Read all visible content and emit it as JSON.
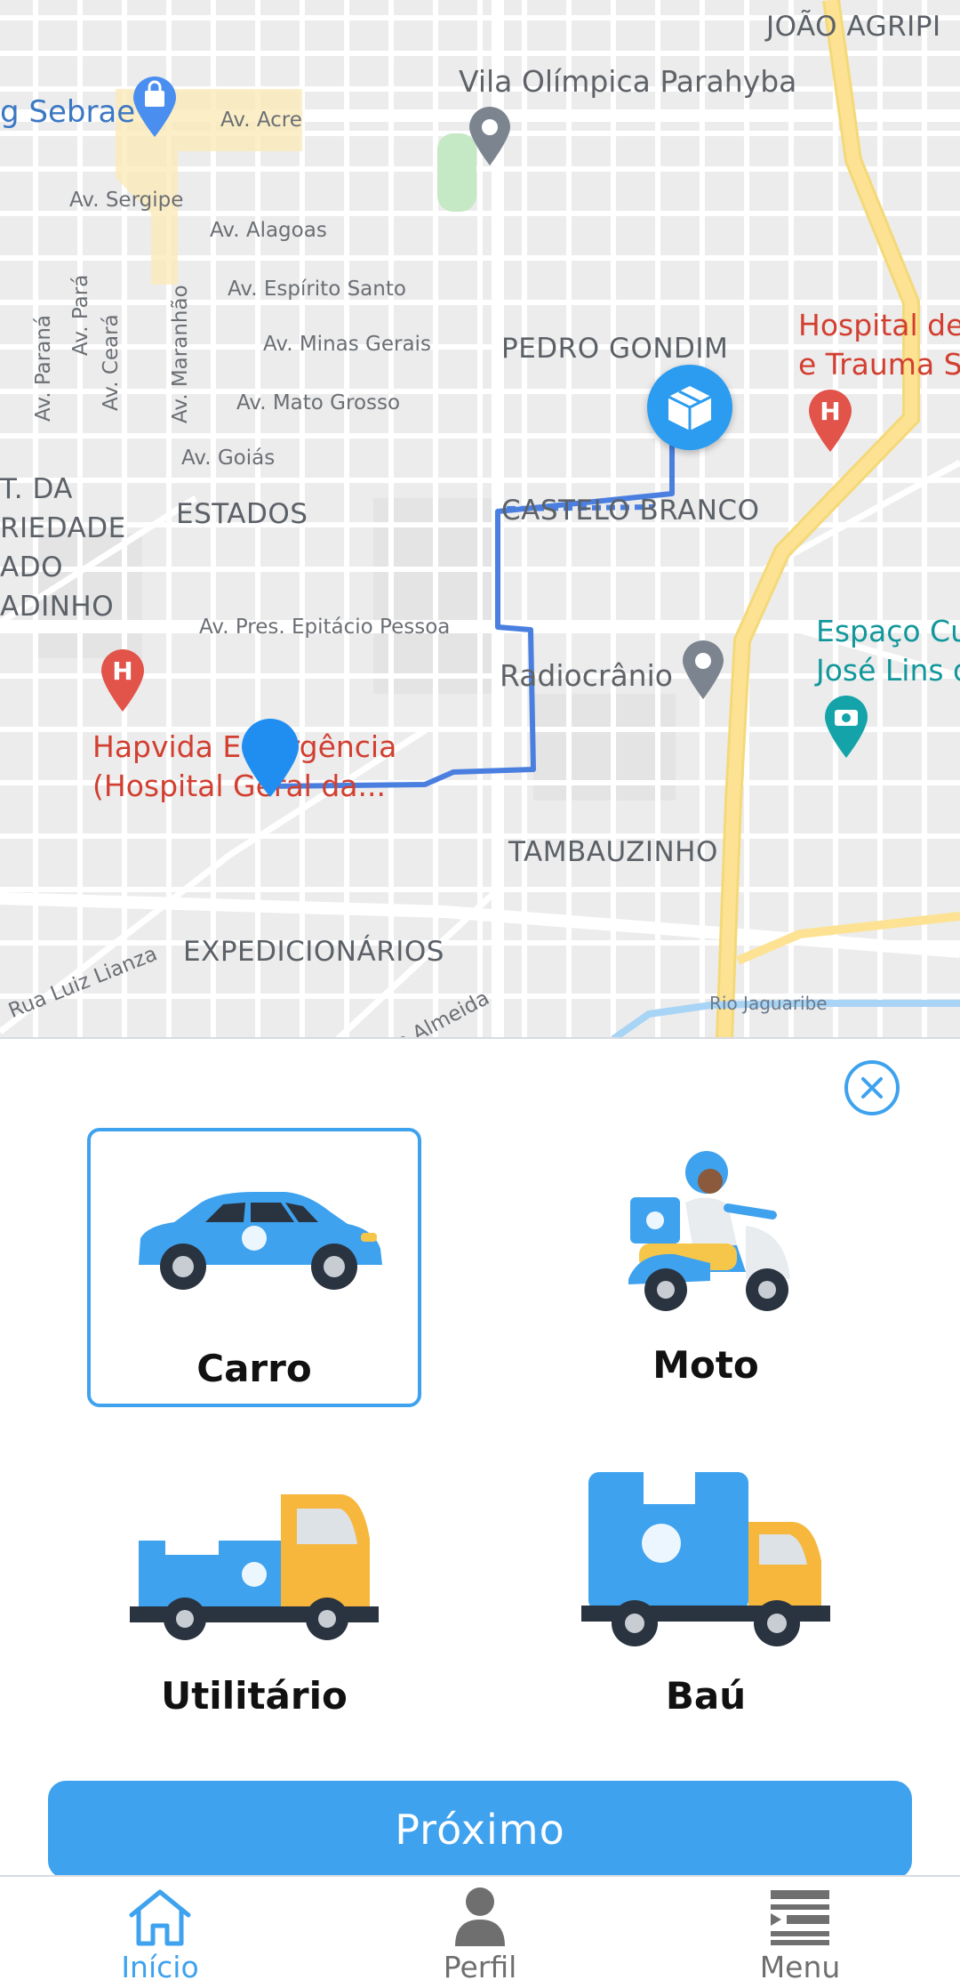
{
  "map": {
    "neighborhoods": {
      "joao_agripino": "JOÃO AGRIPI",
      "pedro_gondim": "PEDRO GONDIM",
      "castelo_branco": "CASTELO BRANCO",
      "estados": "ESTADOS",
      "tambauzinho": "TAMBAUZINHO",
      "expedicionarios": "EXPEDICIONÁRIOS",
      "partial_1": "T. DA",
      "partial_2": "RIEDADE",
      "partial_3": "ADO",
      "partial_4": "ADINHO"
    },
    "streets": {
      "acre": "Av. Acre",
      "sergipe": "Av. Sergipe",
      "alagoas": "Av. Alagoas",
      "espirito_santo": "Av. Espírito Santo",
      "minas_gerais": "Av. Minas Gerais",
      "mato_grosso": "Av. Mato Grosso",
      "goias": "Av. Goiás",
      "epitacio": "Av. Pres. Epitácio Pessoa",
      "parana": "Av. Paraná",
      "para": "Av. Pará",
      "ceara": "Av. Ceará",
      "maranhao": "Av. Maranhão",
      "luiz_lianza": "Rua Luiz Lianza",
      "almeida": "de Almeida",
      "river": "Rio Jaguaribe"
    },
    "pois": {
      "sebrae": "g Sebrae",
      "vila_olimpica": "Vila Olímpica Parahyba",
      "hospital_trauma_1": "Hospital de",
      "hospital_trauma_2": "e Trauma S",
      "radiocranio": "Radiocrânio",
      "espaco_1": "Espaço Cu",
      "espaco_2": "José Lins d",
      "hapvida_1": "Hapvida Emergência",
      "hapvida_2": "(Hospital Geral da..."
    }
  },
  "sheet": {
    "vehicles": [
      {
        "label": "Carro",
        "icon": "car-icon",
        "selected": true
      },
      {
        "label": "Moto",
        "icon": "motorcycle-icon",
        "selected": false
      },
      {
        "label": "Utilitário",
        "icon": "pickup-truck-icon",
        "selected": false
      },
      {
        "label": "Baú",
        "icon": "box-truck-icon",
        "selected": false
      }
    ],
    "next_label": "Próximo"
  },
  "nav": {
    "items": [
      {
        "label": "Início",
        "icon": "home-icon",
        "active": true
      },
      {
        "label": "Perfil",
        "icon": "user-icon",
        "active": false
      },
      {
        "label": "Menu",
        "icon": "menu-icon",
        "active": false
      }
    ]
  },
  "colors": {
    "accent": "#3ea2ee",
    "route": "#4a7fe0",
    "hospital_red": "#d23f31",
    "major_road": "#fde293"
  }
}
